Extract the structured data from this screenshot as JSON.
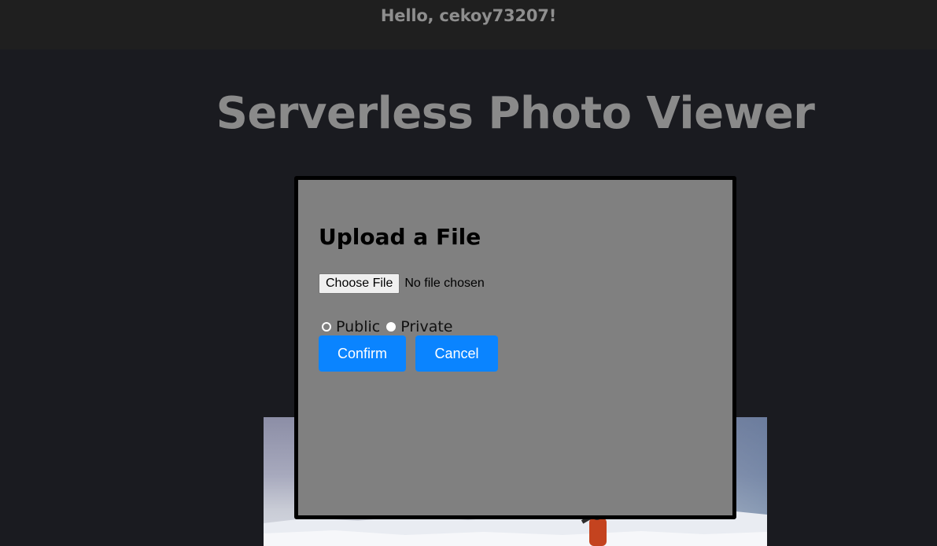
{
  "header": {
    "greeting": "Hello, cekoy73207!"
  },
  "app": {
    "title": "Serverless Photo Viewer"
  },
  "upload_modal": {
    "title": "Upload a File",
    "choose_file_label": "Choose File",
    "file_status": "No file chosen",
    "visibility_options": [
      {
        "label": "Public",
        "selected": false
      },
      {
        "label": "Private",
        "selected": false
      }
    ],
    "confirm_label": "Confirm",
    "cancel_label": "Cancel"
  },
  "colors": {
    "page_background": "#1a1b20",
    "topbar_background": "#1f1f1f",
    "modal_background": "#808080",
    "button_accent": "#0a84ff"
  }
}
